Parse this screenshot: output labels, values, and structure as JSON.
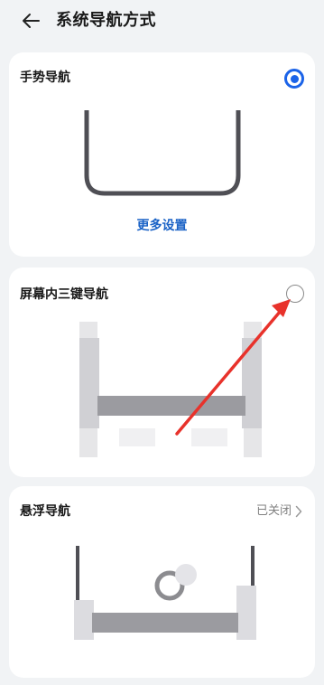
{
  "header": {
    "title": "系统导航方式",
    "back_icon": "arrow-left-icon"
  },
  "cards": {
    "gesture": {
      "title": "手势导航",
      "selected": true,
      "more_settings_label": "更多设置"
    },
    "three_key": {
      "title": "屏幕内三键导航",
      "selected": false
    },
    "floating": {
      "title": "悬浮导航",
      "status": "已关闭",
      "chevron_icon": "chevron-right-icon"
    }
  },
  "colors": {
    "accent": "#1b63e8",
    "link": "#1a62c6",
    "annotation_arrow": "#e8322b",
    "background": "#f1f3f5"
  }
}
